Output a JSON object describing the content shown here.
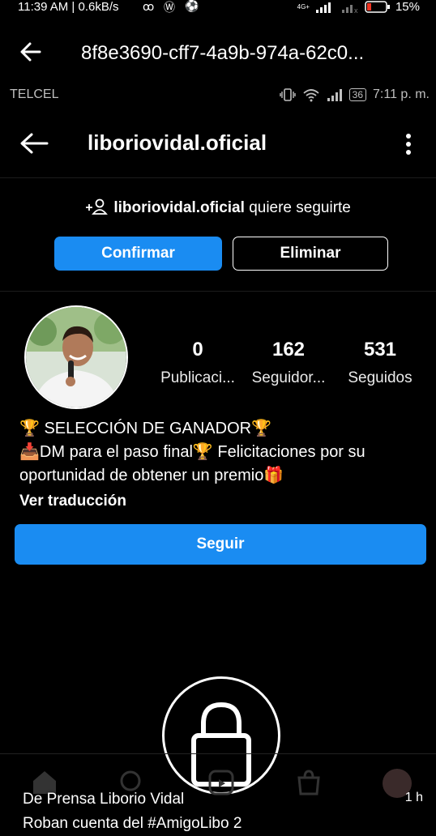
{
  "outer_status": {
    "time_speed": "11:39 AM | 0.6kB/s",
    "battery": "15%",
    "network_label": "4G+"
  },
  "viewer": {
    "title": "8f8e3690-cff7-4a9b-974a-62c0..."
  },
  "inner_status": {
    "carrier": "TELCEL",
    "battery_level": "36",
    "time": "7:11 p. m."
  },
  "profile_header": {
    "username": "liboriovidal.oficial"
  },
  "follow_request": {
    "username": "liboriovidal.oficial",
    "suffix": "quiere seguirte",
    "confirm_label": "Confirmar",
    "delete_label": "Eliminar"
  },
  "stats": [
    {
      "value": "0",
      "label": "Publicaci..."
    },
    {
      "value": "162",
      "label": "Seguidor..."
    },
    {
      "value": "531",
      "label": "Seguidos"
    }
  ],
  "bio": {
    "line1": "🏆 SELECCIÓN DE GANADOR🏆",
    "line2": "📥DM para el paso final🏆 Felicitaciones por su",
    "line3": "oportunidad de obtener un premio🎁",
    "translate": "Ver traducción"
  },
  "follow_button": "Seguir",
  "caption": {
    "line1": "De Prensa Liborio Vidal",
    "line2": "Roban cuenta del #AmigoLibo 2",
    "time": "1 h"
  },
  "colors": {
    "accent": "#1a8cf2",
    "background": "#000000"
  }
}
